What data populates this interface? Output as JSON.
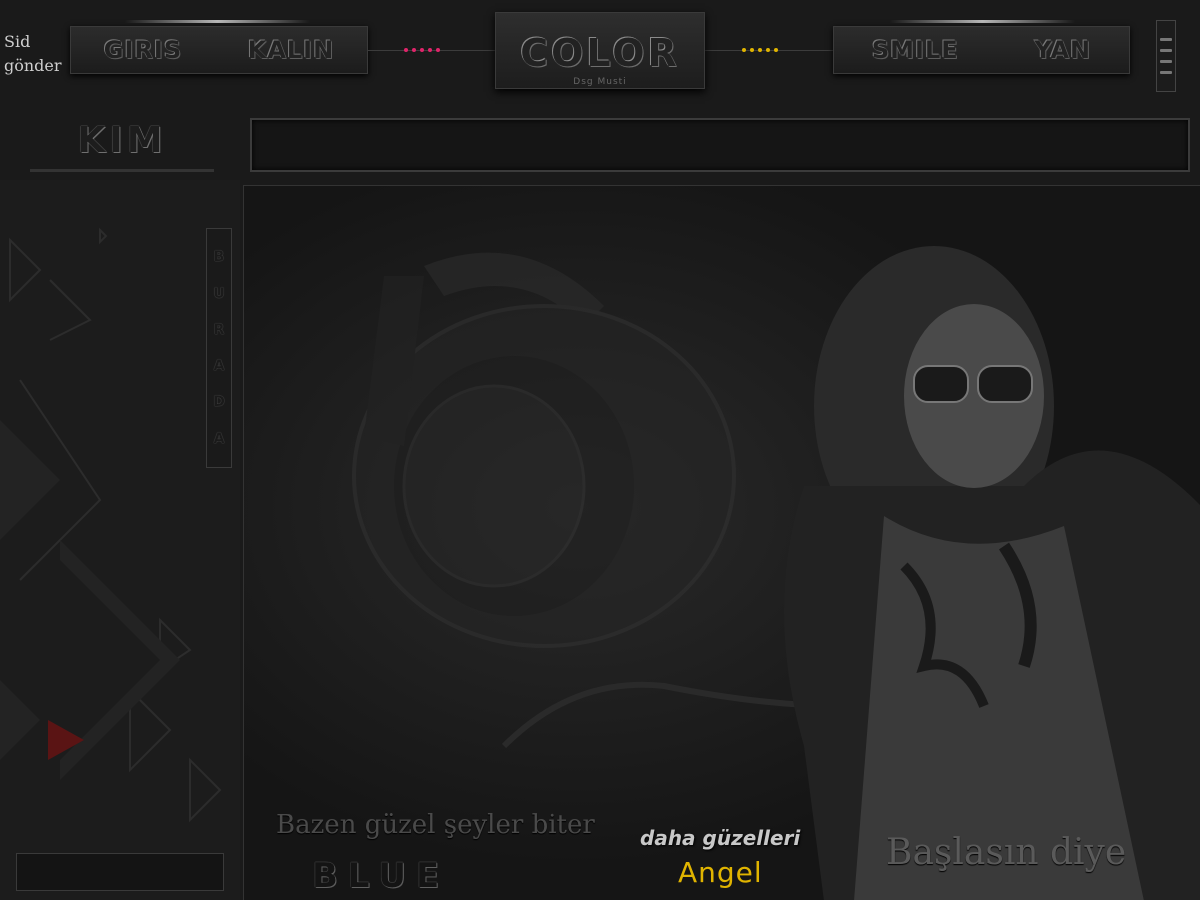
{
  "sid": {
    "label_line1": "Sid",
    "label_line2": "gönder"
  },
  "nav": {
    "left": [
      "GIRIS",
      "KALIN"
    ],
    "right": [
      "SMILE",
      "YAN"
    ]
  },
  "logo": {
    "title": "COLOR",
    "subtitle": "Dsg Musti"
  },
  "side": {
    "title": "KIM",
    "vertical_letters": [
      "B",
      "U",
      "R",
      "A",
      "D",
      "A"
    ]
  },
  "captions": {
    "line1": "Bazen güzel şeyler biter",
    "line2": "daha güzelleri",
    "blue": "BLUE",
    "angel": "Angel",
    "baslasin": "Başlasın diye"
  },
  "colors": {
    "pink_dots": "#e0246a",
    "yellow_dots": "#e0b400",
    "angel": "#e0b400"
  }
}
